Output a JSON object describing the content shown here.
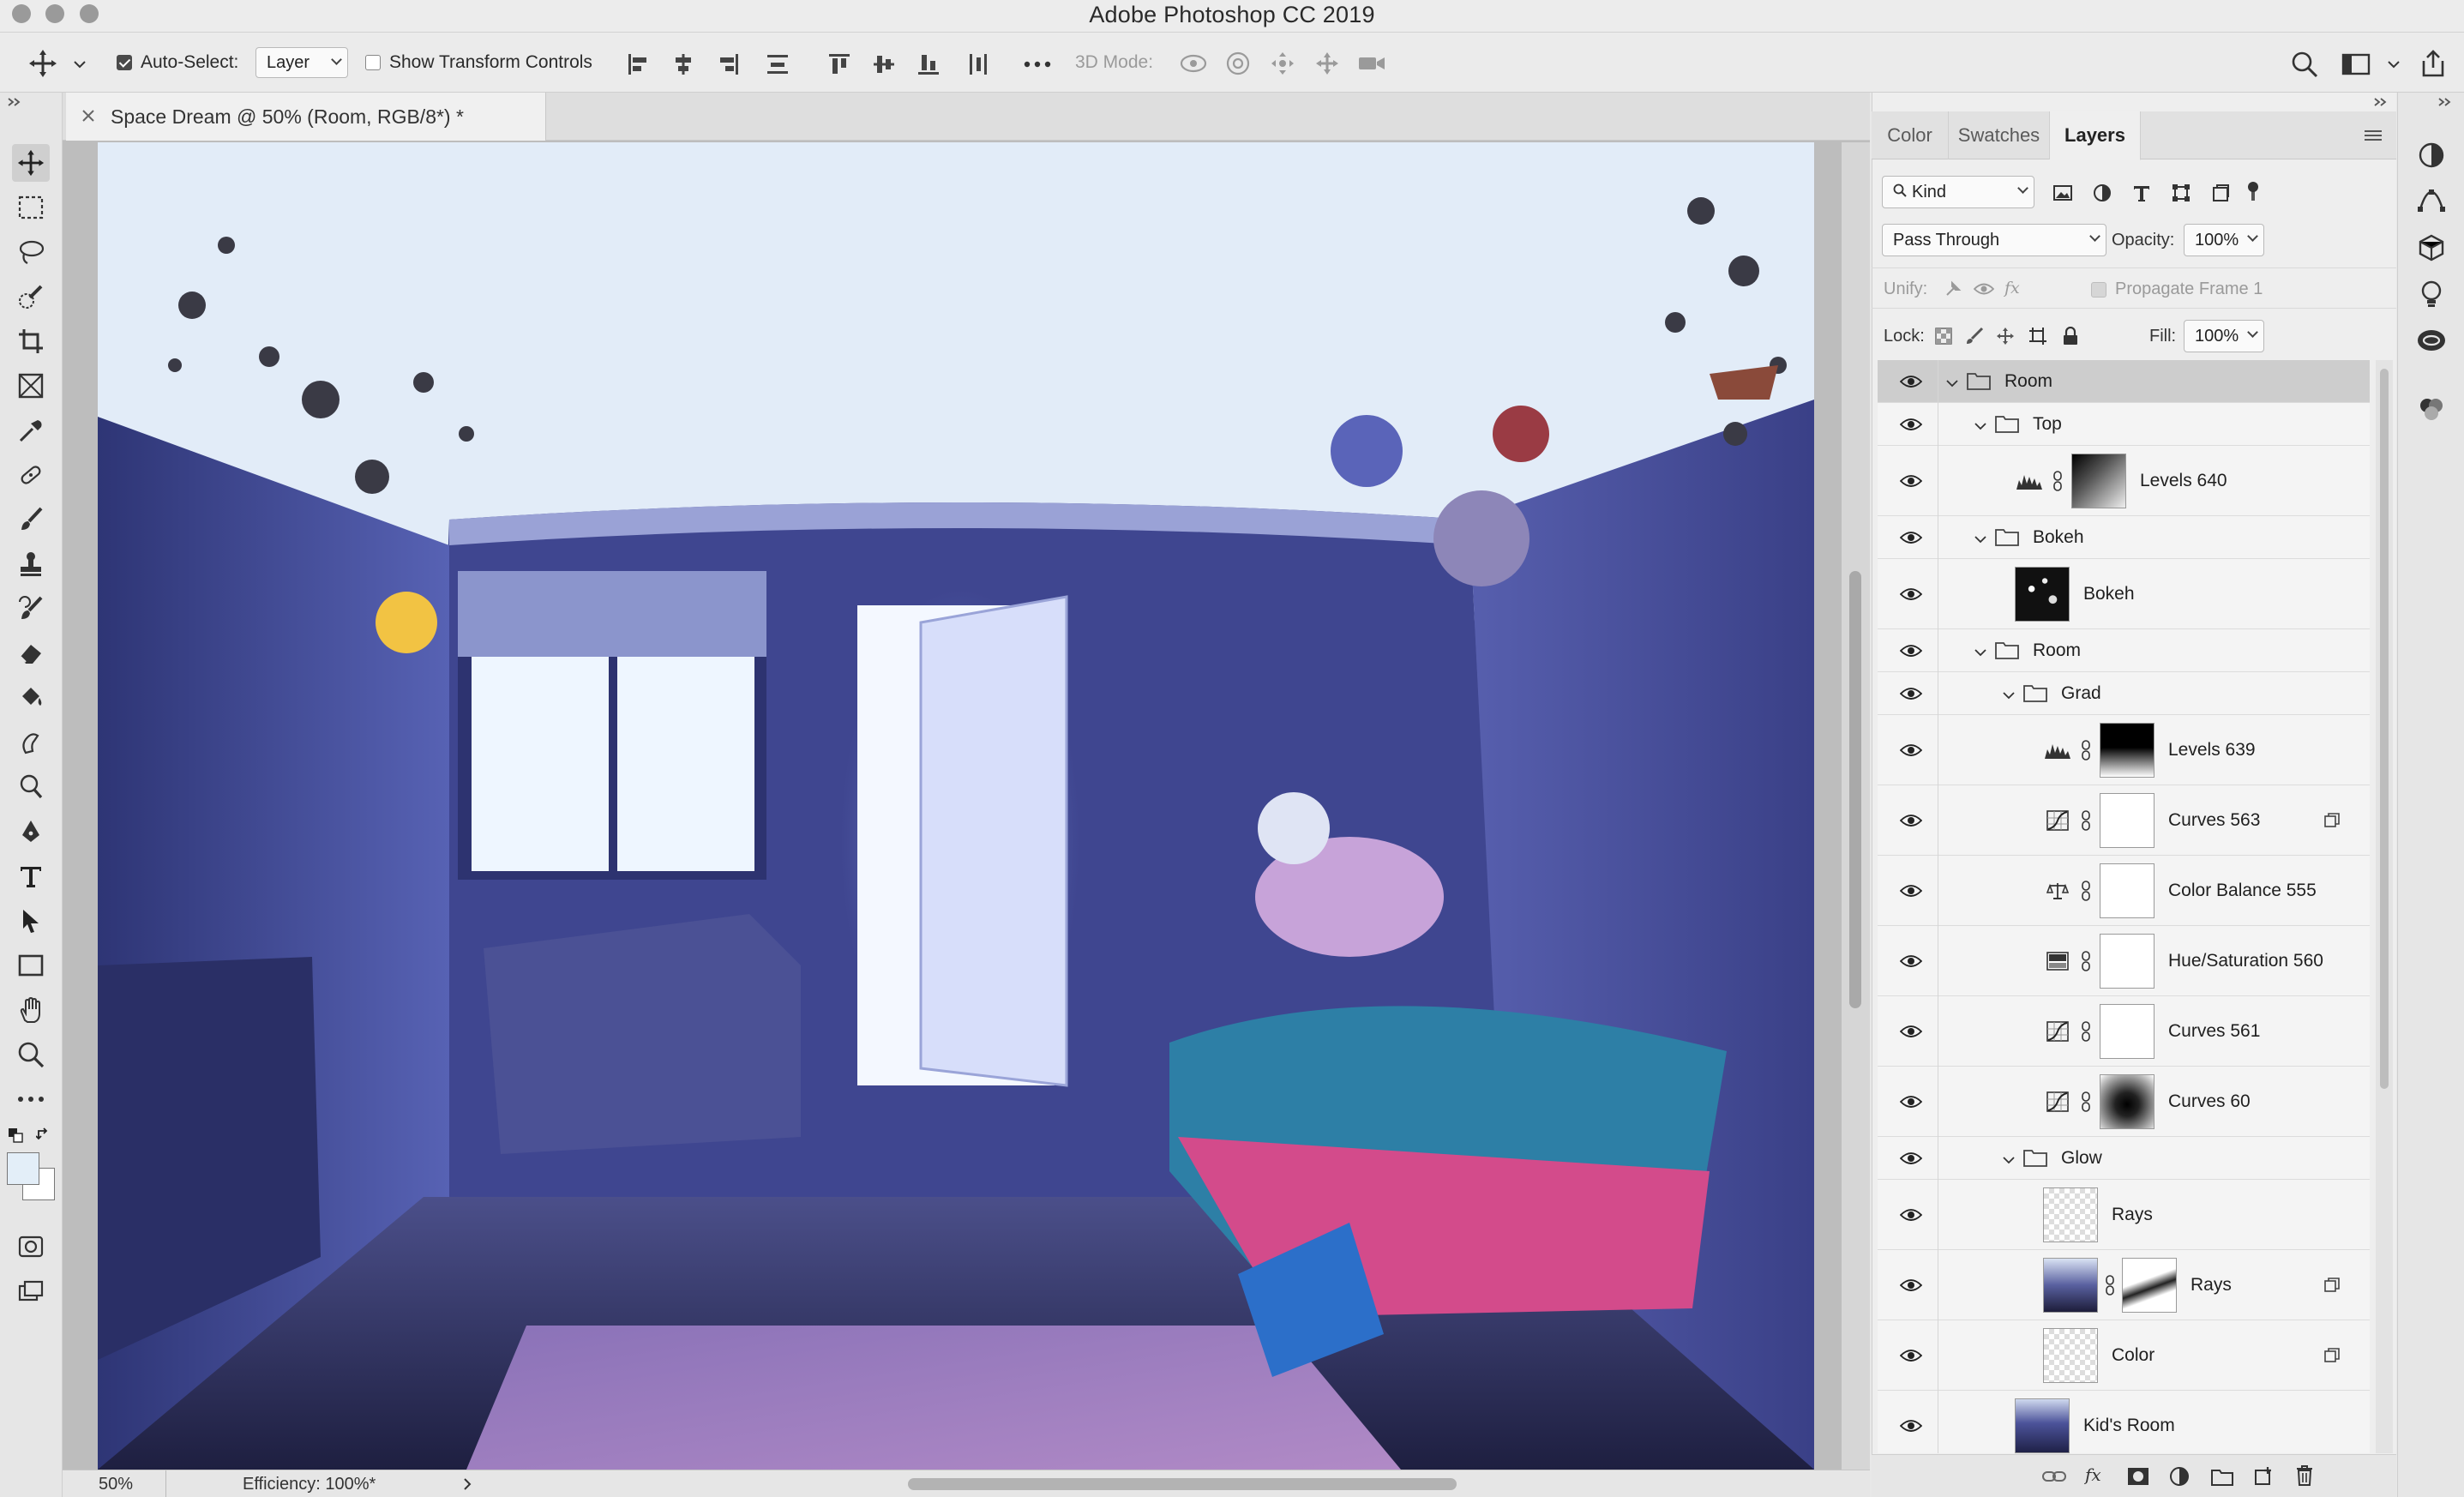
{
  "window": {
    "title": "Adobe Photoshop CC 2019"
  },
  "options_bar": {
    "auto_select_label": "Auto-Select:",
    "auto_select_target": "Layer",
    "show_transform_label": "Show Transform Controls",
    "three_d_mode_label": "3D Mode:"
  },
  "document": {
    "tab_title": "Space Dream @ 50% (Room, RGB/8*) *",
    "zoom": "50%",
    "efficiency": "Efficiency: 100%*"
  },
  "panel": {
    "tabs": [
      "Color",
      "Swatches",
      "Layers"
    ],
    "active_tab": "Layers",
    "filter_kind": "Kind",
    "blend_mode": "Pass Through",
    "opacity_label": "Opacity:",
    "opacity": "100%",
    "unify_label": "Unify:",
    "propagate_label": "Propagate Frame 1",
    "lock_label": "Lock:",
    "fill_label": "Fill:",
    "fill": "100%"
  },
  "layers": [
    {
      "name": "Room",
      "type": "group",
      "depth": 0,
      "selected": true
    },
    {
      "name": "Top",
      "type": "group",
      "depth": 1
    },
    {
      "name": "Levels 640",
      "type": "adjustment",
      "adj_icon": "levels-icon",
      "depth": 2,
      "mask": "gradient-dark"
    },
    {
      "name": "Bokeh",
      "type": "group",
      "depth": 1
    },
    {
      "name": "Bokeh",
      "type": "pixel",
      "depth": 2,
      "thumb": "bokeh"
    },
    {
      "name": "Room",
      "type": "group",
      "depth": 1
    },
    {
      "name": "Grad",
      "type": "group",
      "depth": 2
    },
    {
      "name": "Levels 639",
      "type": "adjustment",
      "adj_icon": "levels-icon",
      "depth": 3,
      "mask": "black-top"
    },
    {
      "name": "Curves 563",
      "type": "adjustment",
      "adj_icon": "curves-icon",
      "depth": 3,
      "mask": "white",
      "clip": true
    },
    {
      "name": "Color Balance 555",
      "type": "adjustment",
      "adj_icon": "color-balance-icon",
      "depth": 3,
      "mask": "white"
    },
    {
      "name": "Hue/Saturation 560",
      "type": "adjustment",
      "adj_icon": "hue-saturation-icon",
      "depth": 3,
      "mask": "white"
    },
    {
      "name": "Curves 561",
      "type": "adjustment",
      "adj_icon": "curves-icon",
      "depth": 3,
      "mask": "white"
    },
    {
      "name": "Curves 60",
      "type": "adjustment",
      "adj_icon": "curves-icon",
      "depth": 3,
      "mask": "radial"
    },
    {
      "name": "Glow",
      "type": "group",
      "depth": 2
    },
    {
      "name": "Rays",
      "type": "pixel",
      "depth": 3,
      "thumb": "transparent"
    },
    {
      "name": "Rays",
      "type": "smart",
      "depth": 3,
      "thumb": "room-small",
      "mask": "rays",
      "clip": true
    },
    {
      "name": "Color",
      "type": "pixel",
      "depth": 3,
      "thumb": "transparent",
      "clip": true
    },
    {
      "name": "Kid's Room",
      "type": "pixel",
      "depth": 2,
      "thumb": "room"
    }
  ],
  "colors": {
    "ui_bg": "#ececec",
    "selected_row": "#cdcdcd",
    "foreground_swatch": "#e3eef8",
    "background_swatch": "#ffffff"
  }
}
